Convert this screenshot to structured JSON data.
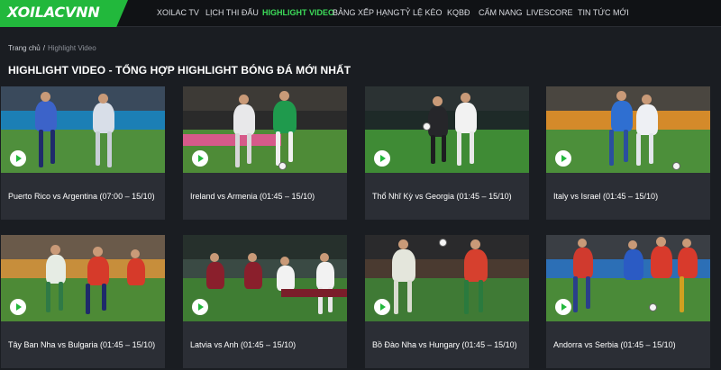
{
  "header": {
    "logo": "XOILACVNN",
    "nav": [
      {
        "label": "XOILAC TV"
      },
      {
        "label": "LỊCH THI ĐẤU"
      },
      {
        "label": "HIGHLIGHT VIDEO",
        "active": true
      },
      {
        "label": "BẢNG XẾP HẠNG"
      },
      {
        "label": "TỶ LỆ KÈO"
      },
      {
        "label": "KQBĐ"
      },
      {
        "label": "CẨM NANG"
      },
      {
        "label": "LIVESCORE"
      },
      {
        "label": "TIN TỨC MỚI"
      }
    ]
  },
  "breadcrumb": {
    "home": "Trang chủ",
    "separator": "/",
    "current": "Highlight Video"
  },
  "page_title": "HIGHLIGHT VIDEO - TỔNG HỢP HIGHLIGHT BÓNG ĐÁ MỚI NHẤT",
  "videos": [
    {
      "title": "Puerto Rico vs Argentina (07:00 – 15/10)"
    },
    {
      "title": "Ireland vs Armenia (01:45 – 15/10)"
    },
    {
      "title": "Thổ Nhĩ Kỳ vs Georgia (01:45 – 15/10)"
    },
    {
      "title": "Italy vs Israel (01:45 – 15/10)"
    },
    {
      "title": "Tây Ban Nha vs Bulgaria (01:45 – 15/10)"
    },
    {
      "title": "Latvia vs Anh (01:45 – 15/10)"
    },
    {
      "title": "Bồ Đào Nha vs Hungary (01:45 – 15/10)"
    },
    {
      "title": "Andorra vs Serbia (01:45 – 15/10)"
    }
  ],
  "colors": {
    "accent": "#22b83c",
    "background": "#1a1d22",
    "card": "#2b2e35"
  },
  "icons": {
    "play": "play-icon"
  }
}
